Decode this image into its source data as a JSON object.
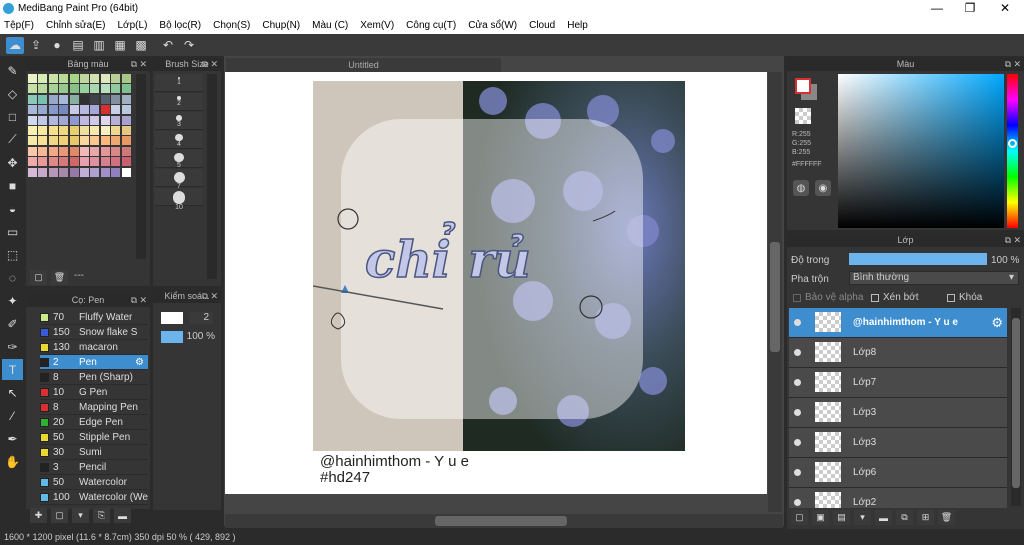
{
  "app": {
    "title": "MediBang Paint Pro (64bit)"
  },
  "window_controls": {
    "minimize": "—",
    "maximize": "❐",
    "close": "✕"
  },
  "menu": [
    "Tệp(F)",
    "Chỉnh sửa(E)",
    "Lớp(L)",
    "Bộ lọc(R)",
    "Chọn(S)",
    "Chụp(N)",
    "Màu (C)",
    "Xem(V)",
    "Công cụ(T)",
    "Cửa sổ(W)",
    "Cloud",
    "Help"
  ],
  "palette": {
    "title": "Bảng màu",
    "footer": "---"
  },
  "brush_size": {
    "title": "Brush Size",
    "sizes": [
      "1",
      "2",
      "3",
      "4",
      "5",
      "7",
      "10"
    ]
  },
  "brush_panel": {
    "title": "Cọ: Pen",
    "items": [
      {
        "size": "70",
        "name": "Fluffy Water",
        "color": "#c8e88a"
      },
      {
        "size": "150",
        "name": "Snow flake S",
        "color": "#3a5ad8"
      },
      {
        "size": "130",
        "name": "macaron",
        "color": "#e8d830"
      },
      {
        "size": "2",
        "name": "Pen",
        "color": "#222222"
      },
      {
        "size": "8",
        "name": "Pen (Sharp)",
        "color": "#222222"
      },
      {
        "size": "10",
        "name": "G Pen",
        "color": "#d83030"
      },
      {
        "size": "8",
        "name": "Mapping Pen",
        "color": "#d83030"
      },
      {
        "size": "20",
        "name": "Edge Pen",
        "color": "#30b030"
      },
      {
        "size": "50",
        "name": "Stipple Pen",
        "color": "#e8d830"
      },
      {
        "size": "30",
        "name": "Sumi",
        "color": "#e8d830"
      },
      {
        "size": "3",
        "name": "Pencil",
        "color": "#222222"
      },
      {
        "size": "50",
        "name": "Watercolor",
        "color": "#60b8e8"
      },
      {
        "size": "100",
        "name": "Watercolor (We",
        "color": "#60b8e8"
      }
    ]
  },
  "kiem": {
    "title": "Kiểm soá...",
    "size_value": "2",
    "opacity_value": "100 %"
  },
  "canvas": {
    "tab": "Untitled",
    "artwork_text": "chỉ rủ",
    "caption_line1": "@hainhimthom - Y u e",
    "caption_line2": "#hd247"
  },
  "color_panel": {
    "title": "Màu",
    "r": "R:255",
    "g": "G:255",
    "b": "B:255",
    "hex": "#FFFFFF"
  },
  "layer_panel": {
    "title": "Lớp",
    "opacity_label": "Độ trong",
    "opacity_value": "100 %",
    "blend_label": "Pha trộn",
    "blend_value": "Bình thường",
    "protect_alpha": "Bảo vệ alpha",
    "clip": "Xén bớt",
    "lock": "Khóa",
    "layers": [
      "@hainhimthom - Y u e",
      "Lớp8",
      "Lớp7",
      "Lớp3",
      "Lớp3",
      "Lớp6",
      "Lớp2"
    ]
  },
  "status": {
    "text": "1600 * 1200 pixel   (11.6 * 8.7cm)   350 dpi   50 %   ( 429, 892 )"
  },
  "colors": {
    "accent": "#3e8ecf",
    "panel": "#353535",
    "bg": "#2b2b2b"
  }
}
